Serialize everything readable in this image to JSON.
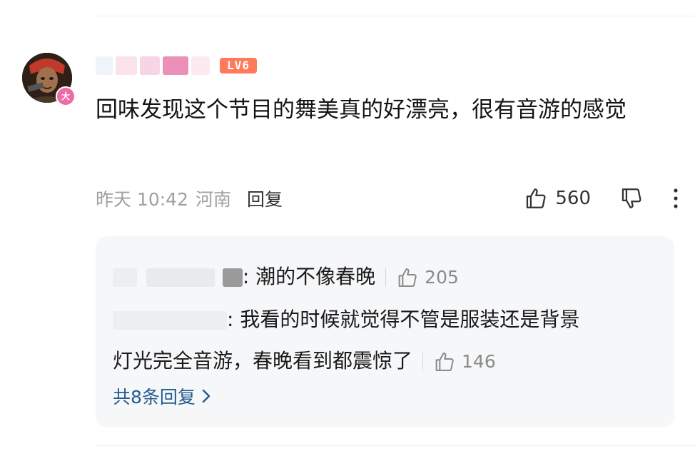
{
  "comment": {
    "level": "LV6",
    "avatar_badge": "大",
    "text": "回味发现这个节目的舞美真的好漂亮，很有音游的感觉",
    "time": "昨天 10:42",
    "location": "河南",
    "reply_label": "回复",
    "likes": "560"
  },
  "replies": [
    {
      "text": "潮的不像春晚",
      "likes": "205"
    },
    {
      "text_line1": "我看的时候就觉得不管是服装还是背景",
      "text_line2": "灯光完全音游，春晚看到都震惊了",
      "likes": "146"
    }
  ],
  "more_replies_label": "共8条回复",
  "colors": {
    "level_badge": "#ff7a5a",
    "avatar_badge": "#f06aa8",
    "link": "#245b8f",
    "reply_bg": "#f6f7f9"
  },
  "icons": [
    "thumb-up-icon",
    "thumb-down-icon",
    "more-vertical-icon",
    "chevron-right-icon"
  ]
}
